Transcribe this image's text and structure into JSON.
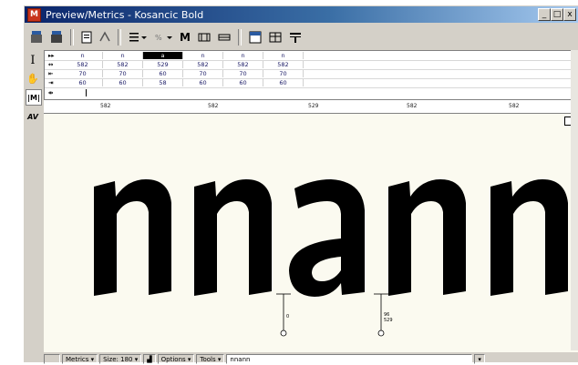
{
  "window": {
    "title": "Preview/Metrics - Kosancic Bold",
    "app_icon_letter": "M",
    "controls": [
      "_",
      "□",
      "x"
    ]
  },
  "toolbar": {
    "items": [
      {
        "name": "save-afm-icon",
        "label": ""
      },
      {
        "name": "open-afm-icon",
        "label": ""
      },
      {
        "name": "page-icon",
        "label": ""
      },
      {
        "name": "kern-icon",
        "label": ""
      },
      {
        "name": "text-align-icon",
        "label": ""
      },
      {
        "name": "metrics-dropdown",
        "label": ""
      },
      {
        "name": "metrics-m-button",
        "label": "M"
      },
      {
        "name": "tool-button-1",
        "label": ""
      },
      {
        "name": "tool-button-2",
        "label": ""
      },
      {
        "name": "panel-button-1",
        "label": ""
      },
      {
        "name": "panel-button-2",
        "label": ""
      },
      {
        "name": "panel-button-3",
        "label": ""
      }
    ]
  },
  "leftbar": {
    "tools": [
      {
        "name": "text-cursor-tool",
        "label": "I"
      },
      {
        "name": "hand-tool",
        "label": "✋"
      },
      {
        "name": "metrics-tool",
        "label": "|M|"
      },
      {
        "name": "kern-tool",
        "label": "AV"
      }
    ]
  },
  "metrics_table": {
    "glyph_row": [
      "n",
      "n",
      "a",
      "n",
      "n",
      "n"
    ],
    "width_row": [
      "582",
      "582",
      "529",
      "582",
      "582",
      "582"
    ],
    "lsb_row": [
      "70",
      "70",
      "60",
      "70",
      "70",
      "70"
    ],
    "rsb_row": [
      "60",
      "60",
      "58",
      "60",
      "60",
      "60"
    ],
    "selected_index": 2
  },
  "ruler": {
    "labels": [
      "582",
      "582",
      "529",
      "582",
      "582"
    ]
  },
  "canvas": {
    "text": "nnann",
    "markers": [
      "0",
      "96 529"
    ]
  },
  "statusbar": {
    "metrics_label": "Metrics",
    "size_label": "Size: 180",
    "options_label": "Options",
    "tools_label": "Tools",
    "input_value": "nnann"
  }
}
